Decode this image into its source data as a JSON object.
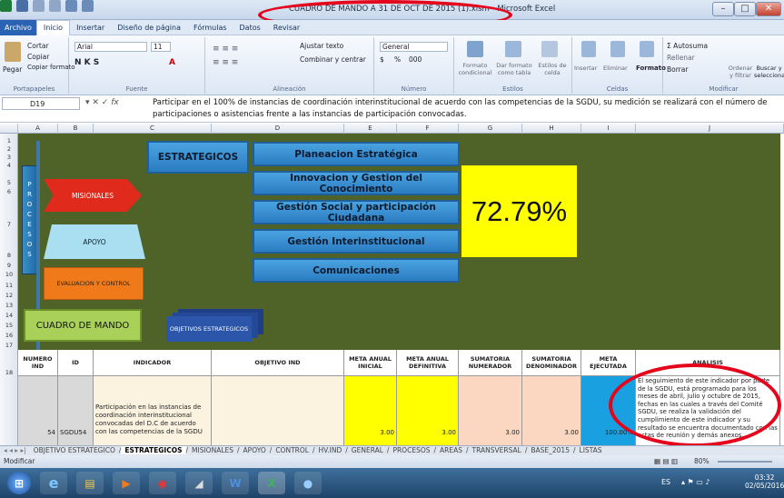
{
  "window": {
    "title": "CUADRO DE MANDO A 31 DE OCT DE 2015 (1).xlsm - Microsoft Excel",
    "minimize": "–",
    "maximize": "□",
    "close": "✕"
  },
  "menu": [
    "Archivo",
    "Inicio",
    "Insertar",
    "Diseño de página",
    "Fórmulas",
    "Datos",
    "Revisar"
  ],
  "ribbon": {
    "portapapeles": {
      "label": "Portapapeles",
      "pegar": "Pegar",
      "cortar": "Cortar",
      "copiar": "Copiar",
      "copiar_formato": "Copiar formato"
    },
    "fuente": {
      "label": "Fuente",
      "font": "Arial",
      "size": "11"
    },
    "alineacion": {
      "label": "Alineación",
      "ajustar": "Ajustar texto",
      "combinar": "Combinar y centrar"
    },
    "numero": {
      "label": "Número",
      "format": "General",
      "currency": "$",
      "percent": "%",
      "thousands": "000"
    },
    "estilos": {
      "label": "Estilos",
      "formato_condicional": "Formato condicional",
      "dar_formato": "Dar formato como tabla",
      "estilos_celda": "Estilos de celda"
    },
    "celdas": {
      "label": "Celdas",
      "insertar": "Insertar",
      "eliminar": "Eliminar",
      "formato": "Formato"
    },
    "modificar": {
      "label": "Modificar",
      "autosuma": "Autosuma",
      "rellenar": "Rellenar",
      "borrar": "Borrar",
      "ordenar": "Ordenar y filtrar",
      "buscar": "Buscar y seleccionar"
    }
  },
  "formula_bar": {
    "name_box": "D19",
    "fx": "fx",
    "formula": "Participar en el 100% de instancias de coordinación interinstitucional de acuerdo  con las competencias de la SGDU, su medición se realizará con el número de participaciones o asistencias frente a las instancias de participación convocadas."
  },
  "columns": [
    "A",
    "B",
    "C",
    "D",
    "E",
    "F",
    "G",
    "H",
    "I",
    "J"
  ],
  "rows": [
    "1",
    "2",
    "3",
    "4",
    "5",
    "6",
    "7",
    "8",
    "9",
    "10",
    "11",
    "12",
    "13",
    "14",
    "15",
    "16",
    "17",
    "18"
  ],
  "dashboard": {
    "procesos_letters": [
      "P",
      "R",
      "O",
      "C",
      "E",
      "S",
      "O",
      "S"
    ],
    "estrategicos": "ESTRATEGICOS",
    "misionales": "MISIONALES",
    "apoyo": "APOYO",
    "evaluacion": "EVALUACION Y CONTROL",
    "cuadro": "CUADRO DE MANDO",
    "objetivos": "OBJETIVOS ESTRATEGICOS",
    "menu_items": [
      "Planeacion Estratégica",
      "Innovacion  y  Gestion del Conocimiento",
      "Gestión Social y participación Ciudadana",
      "Gestión  Interinstitucional",
      "Comunicaciones"
    ],
    "percentage": "72.79%"
  },
  "table": {
    "headers": [
      "NUMERO IND",
      "ID",
      "INDICADOR",
      "OBJETIVO IND",
      "META ANUAL INICIAL",
      "META ANUAL DEFINITIVA",
      "SUMATORIA NUMERADOR",
      "SUMATORIA DENOMINADOR",
      "META EJECUTADA",
      "ANALISIS"
    ],
    "row": {
      "numero": "54",
      "id": "SGDU54",
      "indicador": "Participación en las instancias de coordinación interinstitucional convocadas del D.C de acuerdo con las competencias de la SGDU",
      "objetivo": "",
      "meta_inicial": "3.00",
      "meta_definitiva": "3.00",
      "sum_num": "3.00",
      "sum_den": "3.00",
      "meta_ejecutada": "100.00%",
      "analisis": "El seguimiento de este indicador por parte de la SGDU, está programado para los meses de abril, julio y octubre de 2015, fechas en las cuales a través del Comité SGDU, se realiza  la validación del cumplimiento de este indicador y su resultado se encuentra documentado con las actas de reunión y demás anexos."
    }
  },
  "sheet_tabs": [
    "OBJETIVO ESTRATEGICO",
    "ESTRATEGICOS",
    "MISIONALES",
    "APOYO",
    "CONTROL",
    "HV.IND",
    "GENERAL",
    "PROCESOS",
    "AREAS",
    "TRANSVERSAL",
    "BASE_2015",
    "LISTAS"
  ],
  "active_sheet": "ESTRATEGICOS",
  "status": {
    "mode": "Modificar",
    "zoom": "80%"
  },
  "taskbar": {
    "lang": "ES",
    "time": "03:32",
    "date": "02/05/2016"
  },
  "colors": {
    "dash_bg": "#4f6228",
    "pct_bg": "#ffff00",
    "highlight_ring": "#e4051c"
  }
}
